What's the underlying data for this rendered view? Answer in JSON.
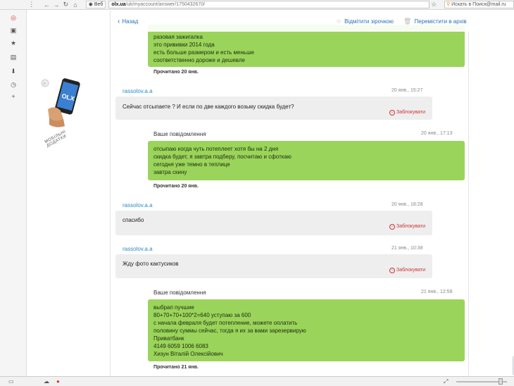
{
  "browser": {
    "site_button": "Веб",
    "url_domain": "olx.ua",
    "url_path": "/uk/myaccount/answer/1750432670/",
    "search_placeholder": "Искать в Поиск@mail.ru"
  },
  "header": {
    "back_label": "Назад",
    "star_label": "Відмітити зірочкою",
    "archive_label": "Перемістити в архів"
  },
  "promo": {
    "text": "мобільні додатки"
  },
  "messages": {
    "m1": {
      "lines": [
        "разовая зажигалка",
        "это прививки 2014 года",
        "есть больше размером и есть меньше",
        "соответственно дороже и дешевле"
      ],
      "read": "Прочитано 20 янв."
    },
    "m2": {
      "author": "rassolov.a.a",
      "date": "20 янв., 15:27",
      "text": "Сейчас отсыпаете ? И если по две каждого возьму скидка будет?",
      "block": "Заблокувати"
    },
    "m3": {
      "author": "Ваше повідомлення",
      "date": "20 янв., 17:13",
      "lines": [
        "отсыпаю когда чуть потеплеет хотя бы на 2 дня",
        "скидка будет, я завтра подберу, посчитаю и сфоткаю",
        "сегодня уже темно в теплице",
        "завтра скину"
      ],
      "read": "Прочитано 20 янв."
    },
    "m4": {
      "author": "rassolov.a.a",
      "date": "20 янв., 18:28",
      "text": "спасибо",
      "block": "Заблокувати"
    },
    "m5": {
      "author": "rassolov.a.a",
      "date": "21 янв., 10:38",
      "text": "Жду фото кактусиков",
      "block": "Заблокувати"
    },
    "m6": {
      "author": "Ваше повідомлення",
      "date": "21 янв., 12:58",
      "lines": [
        "выбрап пучшие",
        "80+70+70+100*2=640 уступаю за 600",
        "с начала февраля будет потепление, можете оплатить",
        "половину суммы сейчас, тогда я их за вами зарезервирую",
        "Приватбанк",
        "4149 6059 1006 6083",
        "Хизун Віталій Олексійович"
      ],
      "read": "Прочитано 21 янв."
    }
  },
  "colors": {
    "bubble_green": "#9bd45a",
    "bubble_gray": "#eeeeee",
    "link_blue": "#2b8bc2",
    "block_red": "#cc3333"
  }
}
